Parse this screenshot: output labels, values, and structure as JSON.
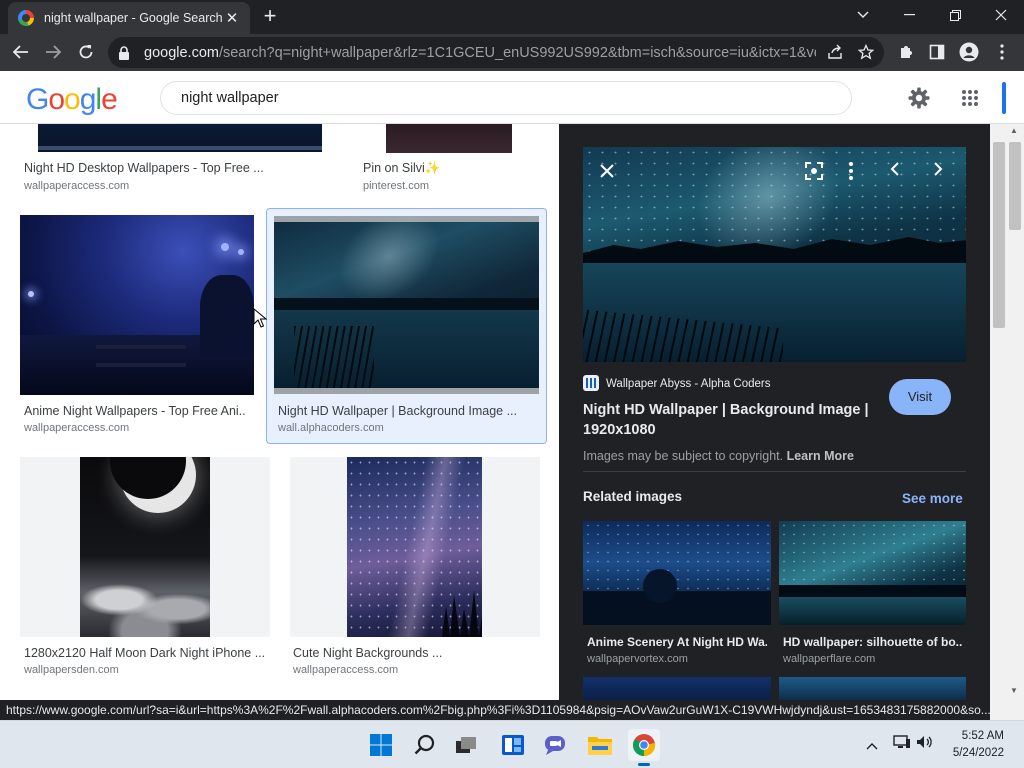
{
  "browser": {
    "tab_title": "night wallpaper - Google Search",
    "tab_close": "✕",
    "new_tab": "+",
    "url_host": "google.com",
    "url_path": "/search?q=night+wallpaper&rlz=1C1GCEU_enUS992US992&tbm=isch&source=iu&ictx=1&vet..."
  },
  "google": {
    "logo_letters": [
      "G",
      "o",
      "o",
      "g",
      "l",
      "e"
    ],
    "logo_colors": [
      "#4285f4",
      "#ea4335",
      "#fbbc05",
      "#4285f4",
      "#34a853",
      "#ea4335"
    ],
    "search_value": "night wallpaper"
  },
  "results": [
    {
      "title": "Night HD Desktop Wallpapers - Top Free ...",
      "source": "wallpaperaccess.com"
    },
    {
      "title": "Pin on Silvi✨",
      "source": "pinterest.com"
    },
    {
      "title": "Anime Night Wallpapers - Top Free Ani...",
      "source": "wallpaperaccess.com"
    },
    {
      "title": "Night HD Wallpaper | Background Image ...",
      "source": "wall.alphacoders.com"
    },
    {
      "title": "1280x2120 Half Moon Dark Night iPhone ...",
      "source": "wallpapersden.com"
    },
    {
      "title": "Cute Night Backgrounds ...",
      "source": "wallpaperaccess.com"
    }
  ],
  "panel": {
    "site_name": "Wallpaper Abyss - Alpha Coders",
    "title": "Night HD Wallpaper | Background Image | 1920x1080",
    "visit_label": "Visit",
    "copyright_text": "Images may be subject to copyright.",
    "learn_more": "Learn More",
    "related_heading": "Related images",
    "see_more": "See more",
    "related": [
      {
        "title": "Anime Scenery At Night HD Wa...",
        "source": "wallpapervortex.com"
      },
      {
        "title": "HD wallpaper: silhouette of bo...",
        "source": "wallpaperflare.com"
      }
    ]
  },
  "status_url": "https://www.google.com/url?sa=i&url=https%3A%2F%2Fwall.alphacoders.com%2Fbig.php%3Fi%3D1105984&psig=AOvVaw2urGuW1X-C19VWHwjdyndj&ust=1653483175882000&so...",
  "taskbar": {
    "time": "5:52 AM",
    "date": "5/24/2022"
  }
}
